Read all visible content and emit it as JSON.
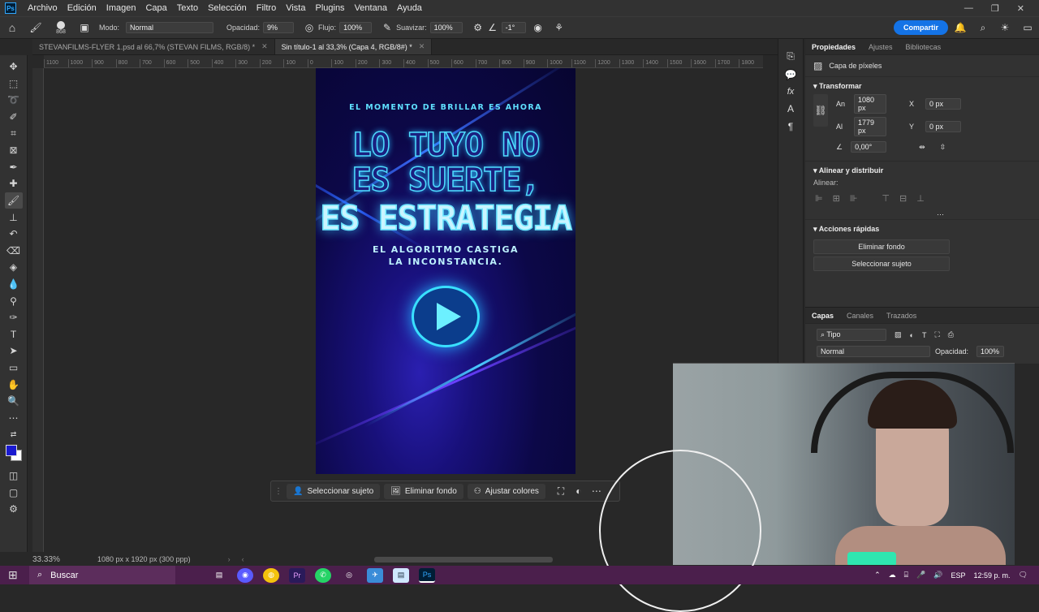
{
  "menubar": {
    "logo": "Ps",
    "items": [
      "Archivo",
      "Edición",
      "Imagen",
      "Capa",
      "Texto",
      "Selección",
      "Filtro",
      "Vista",
      "Plugins",
      "Ventana",
      "Ayuda"
    ]
  },
  "options": {
    "brush_size": "868",
    "mode_label": "Modo:",
    "mode_value": "Normal",
    "opacity_label": "Opacidad:",
    "opacity_value": "9%",
    "flow_label": "Flujo:",
    "flow_value": "100%",
    "smooth_label": "Suavizar:",
    "smooth_value": "100%",
    "angle_value": "-1°",
    "share_label": "Compartir"
  },
  "tabs": [
    {
      "label": "STEVANFILMS-FLYER 1.psd al 66,7% (STEVAN FILMS, RGB/8) *"
    },
    {
      "label": "Sin título-1 al 33,3% (Capa 4, RGB/8#) *"
    }
  ],
  "ruler_ticks": [
    "1100",
    "1000",
    "900",
    "800",
    "700",
    "600",
    "500",
    "400",
    "300",
    "200",
    "100",
    "0",
    "100",
    "200",
    "300",
    "400",
    "500",
    "600",
    "700",
    "800",
    "900",
    "1000",
    "1100",
    "1200",
    "1300",
    "1400",
    "1500",
    "1600",
    "1700",
    "1800"
  ],
  "artwork": {
    "top_line": "EL MOMENTO DE   BRILLAR ES AHORA",
    "line1": "LO TUYO NO",
    "line2": "ES SUERTE,",
    "line3": "ES ESTRATEGIA",
    "sub1": "EL ALGORITMO CASTIGA",
    "sub2": "LA INCONSTANCIA."
  },
  "context_bar": {
    "select_subject": "Seleccionar sujeto",
    "remove_bg": "Eliminar fondo",
    "adjust_colors": "Ajustar colores"
  },
  "status": {
    "zoom": "33.33%",
    "doc_info": "1080 px x 1920 px (300 ppp)"
  },
  "properties": {
    "tabs": [
      "Propiedades",
      "Ajustes",
      "Bibliotecas"
    ],
    "layer_type": "Capa de píxeles",
    "transform_title": "Transformar",
    "w_label": "An",
    "w_value": "1080 px",
    "h_label": "Al",
    "h_value": "1779 px",
    "x_label": "X",
    "x_value": "0 px",
    "y_label": "Y",
    "y_value": "0 px",
    "angle_value": "0,00°",
    "align_title": "Alinear y distribuir",
    "align_label": "Alinear:",
    "quick_title": "Acciones rápidas",
    "quick_btn1": "Eliminar fondo",
    "quick_btn2": "Seleccionar sujeto"
  },
  "layers": {
    "tabs": [
      "Capas",
      "Canales",
      "Trazados"
    ],
    "filter_value": "Tipo",
    "blend_value": "Normal",
    "opacity_label": "Opacidad:",
    "opacity_value": "100%"
  },
  "taskbar": {
    "search_label": "Buscar",
    "lang": "ESP",
    "time": "12:59 p. m."
  },
  "colors": {
    "foreground": "#1a1ad0",
    "background": "#ffffff",
    "accent": "#1473e6",
    "taskbar": "#4b1f4c"
  }
}
